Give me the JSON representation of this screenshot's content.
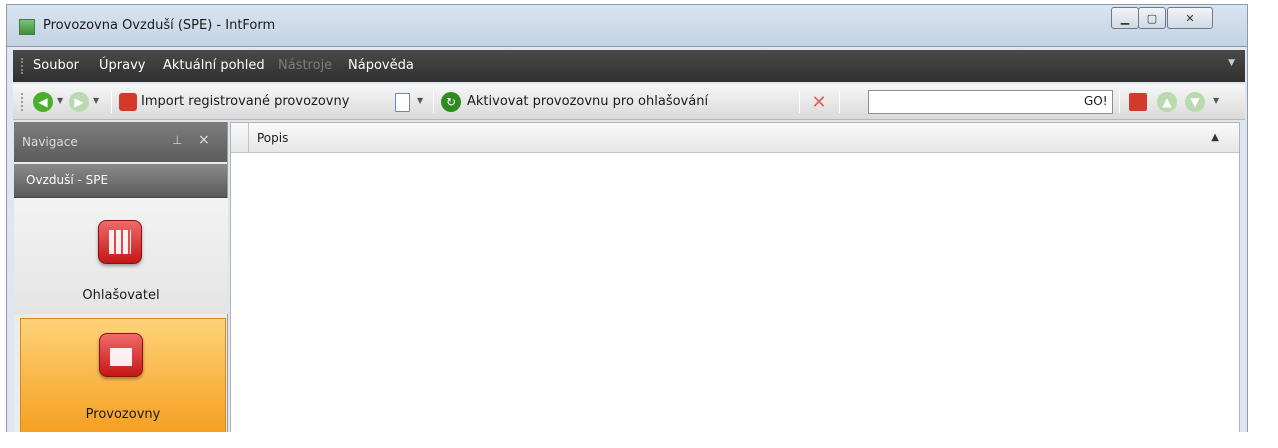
{
  "window": {
    "title": "Provozovna Ovzduší (SPE) - IntForm",
    "min_icon": "minimize-icon",
    "max_icon": "maximize-icon",
    "close_icon": "close-icon"
  },
  "menubar": {
    "items": [
      {
        "label": "Soubor",
        "enabled": true
      },
      {
        "label": "Úpravy",
        "enabled": true
      },
      {
        "label": "Aktuální pohled",
        "enabled": true
      },
      {
        "label": "Nástroje",
        "enabled": false
      },
      {
        "label": "Nápověda",
        "enabled": true
      }
    ]
  },
  "toolbar": {
    "import_label": "Import registrované provozovny",
    "activate_label": "Aktivovat provozovnu pro ohlašování",
    "search_value": "",
    "go_label": "GO!",
    "icons": {
      "back": "back-arrow-icon",
      "forward": "forward-arrow-icon",
      "import": "import-icon",
      "new_document": "new-document-icon",
      "refresh": "refresh-icon",
      "delete": "delete-icon",
      "calculator": "calculator-icon",
      "up": "up-icon",
      "down": "down-icon"
    },
    "colors": {
      "back": "#4caf2a",
      "refresh": "#2e8b1f",
      "delete": "#e06060",
      "import": "#d43a2a"
    }
  },
  "navigation": {
    "title": "Navigace",
    "pin_icon": "pin-icon",
    "close_glyph": "×",
    "group": "Ovzduší - SPE",
    "items": [
      {
        "label": "Ohlašovatel",
        "icon": "building-icon",
        "selected": false
      },
      {
        "label": "Provozovny",
        "icon": "factory-icon",
        "selected": true
      }
    ]
  },
  "grid": {
    "columns": [
      "Popis"
    ],
    "sort_glyph": "▲",
    "rows": []
  }
}
